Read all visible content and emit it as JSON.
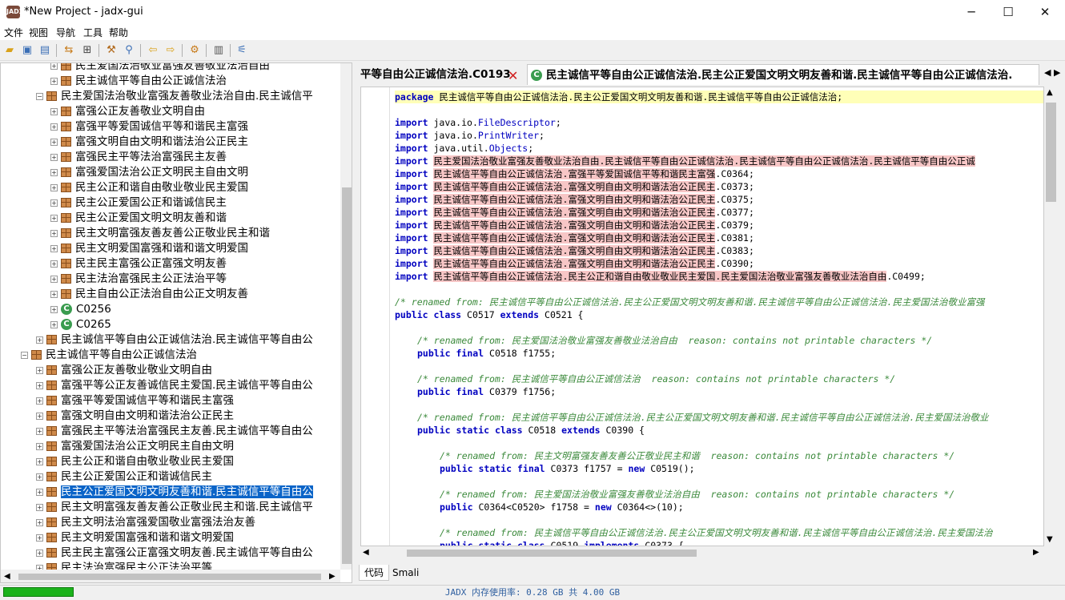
{
  "window": {
    "title": "*New Project - jadx-gui",
    "icon_text": "JADX",
    "controls": {
      "minimize": "─",
      "maximize": "☐",
      "close": "✕"
    }
  },
  "menu": [
    "文件",
    "视图",
    "导航",
    "工具",
    "帮助"
  ],
  "tree": {
    "nodes": [
      {
        "label": "民主爱国法治敬业富强友善敬业法治自由",
        "kind": "pkg"
      },
      {
        "label": "民主诚信平等自由公正诚信法治",
        "kind": "pkg"
      },
      {
        "label": "民主爱国法治敬业富强友善敬业法治自由.民主诚信平",
        "kind": "pkg"
      },
      {
        "label": "富强公正友善敬业文明自由",
        "kind": "pkg"
      },
      {
        "label": "富强平等爱国诚信平等和谐民主富强",
        "kind": "pkg"
      },
      {
        "label": "富强文明自由文明和谐法治公正民主",
        "kind": "pkg"
      },
      {
        "label": "富强民主平等法治富强民主友善",
        "kind": "pkg"
      },
      {
        "label": "富强爱国法治公正文明民主自由文明",
        "kind": "pkg"
      },
      {
        "label": "民主公正和谐自由敬业敬业民主爱国",
        "kind": "pkg"
      },
      {
        "label": "民主公正爱国公正和谐诚信民主",
        "kind": "pkg"
      },
      {
        "label": "民主公正爱国文明文明友善和谐",
        "kind": "pkg"
      },
      {
        "label": "民主文明富强友善友善公正敬业民主和谐",
        "kind": "pkg"
      },
      {
        "label": "民主文明爱国富强和谐和谐文明爱国",
        "kind": "pkg"
      },
      {
        "label": "民主民主富强公正富强文明友善",
        "kind": "pkg"
      },
      {
        "label": "民主法治富强民主公正法治平等",
        "kind": "pkg"
      },
      {
        "label": "民主自由公正法治自由公正文明友善",
        "kind": "pkg"
      },
      {
        "label": "C0256",
        "kind": "cls"
      },
      {
        "label": "C0265",
        "kind": "cls"
      },
      {
        "label": "民主诚信平等自由公正诚信法治.民主诚信平等自由公",
        "kind": "pkg"
      },
      {
        "label": "民主诚信平等自由公正诚信法治",
        "kind": "pkg"
      },
      {
        "label": "富强公正友善敬业敬业文明自由",
        "kind": "pkg"
      },
      {
        "label": "富强平等公正友善诚信民主爱国.民主诚信平等自由公",
        "kind": "pkg"
      },
      {
        "label": "富强平等爱国诚信平等和谐民主富强",
        "kind": "pkg"
      },
      {
        "label": "富强文明自由文明和谐法治公正民主",
        "kind": "pkg"
      },
      {
        "label": "富强民主平等法治富强民主友善.民主诚信平等自由公",
        "kind": "pkg"
      },
      {
        "label": "富强爱国法治公正文明民主自由文明",
        "kind": "pkg"
      },
      {
        "label": "民主公正和谐自由敬业敬业民主爱国",
        "kind": "pkg"
      },
      {
        "label": "民主公正爱国公正和谐诚信民主",
        "kind": "pkg"
      },
      {
        "label": "民主公正爱国文明文明友善和谐.民主诚信平等自由公",
        "kind": "pkg",
        "selected": true
      },
      {
        "label": "民主文明富强友善友善公正敬业民主和谐.民主诚信平",
        "kind": "pkg"
      },
      {
        "label": "民主文明法治富强爱国敬业富强法治友善",
        "kind": "pkg"
      },
      {
        "label": "民主文明爱国富强和谐和谐文明爱国",
        "kind": "pkg"
      },
      {
        "label": "民主民主富强公正富强文明友善.民主诚信平等自由公",
        "kind": "pkg"
      },
      {
        "label": "民主法治富强民主公正法治平等",
        "kind": "pkg"
      }
    ]
  },
  "tabs": [
    {
      "label": "平等自由公正诚信法治.C0193",
      "closable": true
    },
    {
      "label": "民主诚信平等自由公正诚信法治.民主公正爱国文明文明友善和谐.民主诚信平等自由公正诚信法治.",
      "active": true
    }
  ],
  "code": {
    "package_kw": "package",
    "package_name": "民主诚信平等自由公正诚信法治.民主公正爱国文明文明友善和谐.民主诚信平等自由公正诚信法治;",
    "import_kw": "import",
    "imports": [
      {
        "pre": "java.io.",
        "name": "FileDescriptor",
        "post": ";",
        "style": "plain"
      },
      {
        "pre": "java.io.",
        "name": "PrintWriter",
        "post": ";",
        "style": "plain"
      },
      {
        "pre": "java.util.",
        "name": "Objects",
        "post": ";",
        "style": "plain"
      },
      {
        "pre": "",
        "name": "民主爱国法治敬业富强友善敬业法治自由.民主诚信平等自由公正诚信法治.民主诚信平等自由公正诚信法治.民主诚信平等自由公正诚",
        "post": "",
        "style": "err"
      },
      {
        "pre": "",
        "name": "民主诚信平等自由公正诚信法治.富强平等爱国诚信平等和谐民主富强",
        "post": ".C0364;",
        "style": "err"
      },
      {
        "pre": "",
        "name": "民主诚信平等自由公正诚信法治.富强文明自由文明和谐法治公正民主",
        "post": ".C0373;",
        "style": "err"
      },
      {
        "pre": "",
        "name": "民主诚信平等自由公正诚信法治.富强文明自由文明和谐法治公正民主",
        "post": ".C0375;",
        "style": "err"
      },
      {
        "pre": "",
        "name": "民主诚信平等自由公正诚信法治.富强文明自由文明和谐法治公正民主",
        "post": ".C0377;",
        "style": "err"
      },
      {
        "pre": "",
        "name": "民主诚信平等自由公正诚信法治.富强文明自由文明和谐法治公正民主",
        "post": ".C0379;",
        "style": "err"
      },
      {
        "pre": "",
        "name": "民主诚信平等自由公正诚信法治.富强文明自由文明和谐法治公正民主",
        "post": ".C0381;",
        "style": "err"
      },
      {
        "pre": "",
        "name": "民主诚信平等自由公正诚信法治.富强文明自由文明和谐法治公正民主",
        "post": ".C0383;",
        "style": "err"
      },
      {
        "pre": "",
        "name": "民主诚信平等自由公正诚信法治.富强文明自由文明和谐法治公正民主",
        "post": ".C0390;",
        "style": "err"
      },
      {
        "pre": "",
        "name": "民主诚信平等自由公正诚信法治.民主公正和谐自由敬业敬业民主爱国.民主爱国法治敬业富强友善敬业法治自由",
        "post": ".C0499;",
        "style": "err"
      }
    ],
    "comment1": "/* renamed from: 民主诚信平等自由公正诚信法治.民主公正爱国文明文明友善和谐.民主诚信平等自由公正诚信法治.民主爱国法治敬业富强",
    "class_decl": {
      "kw1": "public",
      "kw2": "class",
      "name": "C0517",
      "kw3": "extends",
      "sup": "C0521 {"
    },
    "comment2": "/* renamed from: 民主爱国法治敬业富强友善敬业法治自由  reason: contains not printable characters */",
    "field1": {
      "kw1": "public",
      "kw2": "final",
      "rest": "C0518 f1755;"
    },
    "comment3": "/* renamed from: 民主诚信平等自由公正诚信法治  reason: contains not printable characters */",
    "field2": {
      "kw1": "public",
      "kw2": "final",
      "rest": "C0379 f1756;"
    },
    "comment4": "/* renamed from: 民主诚信平等自由公正诚信法治.民主公正爱国文明文明友善和谐.民主诚信平等自由公正诚信法治.民主爱国法治敬业",
    "inner1": {
      "kw1": "public",
      "kw2": "static",
      "kw3": "class",
      "name": "C0518",
      "kw4": "extends",
      "rest": "C0390 {"
    },
    "comment5": "/* renamed from: 民主文明富强友善友善公正敬业民主和谐  reason: contains not printable characters */",
    "field3": {
      "kw1": "public",
      "kw2": "static",
      "kw3": "final",
      "mid": "C0373 f1757 = ",
      "kw4": "new",
      "rest": "C0519();"
    },
    "comment6": "/* renamed from: 民主爱国法治敬业富强友善敬业法治自由  reason: contains not printable characters */",
    "field4": {
      "kw1": "public",
      "mid": "C0364<C0520> f1758 = ",
      "kw2": "new",
      "rest": "C0364<>(10);"
    },
    "comment7": "/* renamed from: 民主诚信平等自由公正诚信法治.民主公正爱国文明文明友善和谐.民主诚信平等自由公正诚信法治.民主爱国法治",
    "inner2": {
      "kw1": "public",
      "kw2": "static",
      "kw3": "class",
      "name": "C0519",
      "kw4": "implements",
      "rest": "C0373 {"
    }
  },
  "bottom_tabs": [
    "代码",
    "Smali"
  ],
  "status": {
    "memory": "JADX 内存使用率: 0.28 GB 共 4.00 GB",
    "progress": 1.0
  },
  "colors": {
    "selection": "#0a64c8",
    "keyword": "#0000c0",
    "comment": "#3c8a3c",
    "error_bg": "#f7c6c6",
    "highlight": "#ffffb8",
    "progress": "#1bb21b"
  }
}
